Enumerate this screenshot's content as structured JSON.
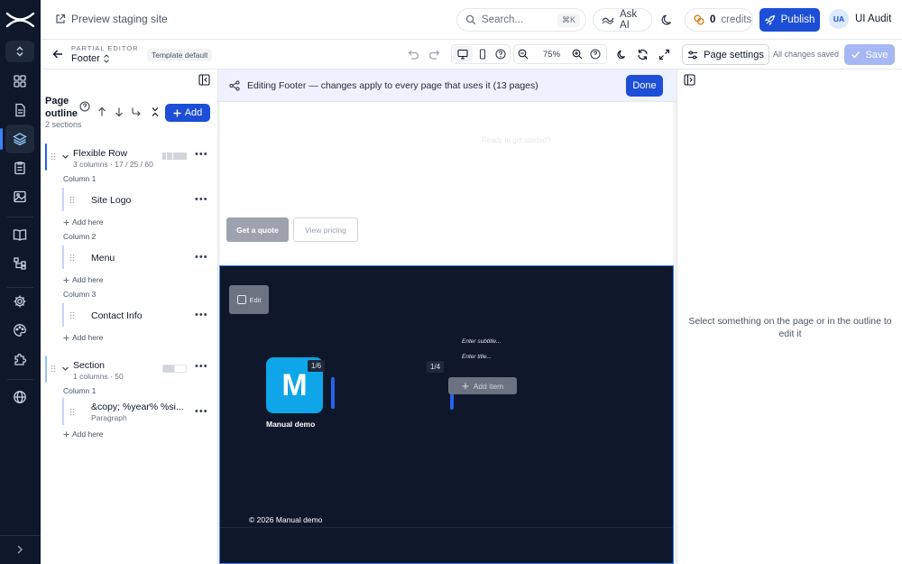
{
  "topbar": {
    "preview_label": "Preview staging site",
    "search_placeholder": "Search...",
    "search_shortcut": "⌘K",
    "ask_ai_label": "Ask AI",
    "credits_count": "0",
    "credits_label": "credits",
    "publish_label": "Publish",
    "user_initials": "UA",
    "user_name": "UI Audit"
  },
  "toolbar": {
    "kind_label": "PARTIAL EDITOR",
    "partial_name": "Footer",
    "template_badge": "Template default",
    "zoom_level": "75%",
    "page_settings_label": "Page settings",
    "save_status": "All changes saved",
    "save_label": "Save"
  },
  "outline": {
    "title": "Page outline",
    "section_count": "2 sections",
    "add_label": "Add",
    "flex_row": {
      "title": "Flexible Row",
      "subtitle": "3 columns · 17 / 25 / 60",
      "columns": [
        {
          "label": "Column 1",
          "item": "Site Logo",
          "add": "Add here"
        },
        {
          "label": "Column 2",
          "item": "Menu",
          "add": "Add here"
        },
        {
          "label": "Column 3",
          "item": "Contact Info",
          "add": "Add here"
        }
      ]
    },
    "section": {
      "title": "Section",
      "subtitle": "1 columns · 50",
      "columns": [
        {
          "label": "Column 1",
          "item": "&copy; %year% %si...",
          "item_type": "Paragraph",
          "add": "Add here"
        }
      ]
    }
  },
  "canvas": {
    "banner_text": "Editing Footer — changes apply to every page that uses it (13 pages)",
    "done_label": "Done",
    "ready_text": "Ready to get started?",
    "quote_button": "Get a quote",
    "pricing_button": "View pricing",
    "footer": {
      "edit_label": "Edit",
      "logo_letter": "M",
      "logo_badge": "1/6",
      "logo_name": "Manual demo",
      "menu_badge": "1/4",
      "subtitle_placeholder": "Enter subtitle...",
      "title_placeholder": "Enter title...",
      "add_item_label": "Add item",
      "copyright": "© 2026 Manual demo"
    }
  },
  "inspector": {
    "empty_hint": "Select something on the page or in the outline to edit it"
  },
  "colors": {
    "rail_bg": "#0f172a",
    "accent": "#1d4ed8",
    "footer_bg": "#0f172a",
    "logo_bg": "#0ea5e9"
  }
}
